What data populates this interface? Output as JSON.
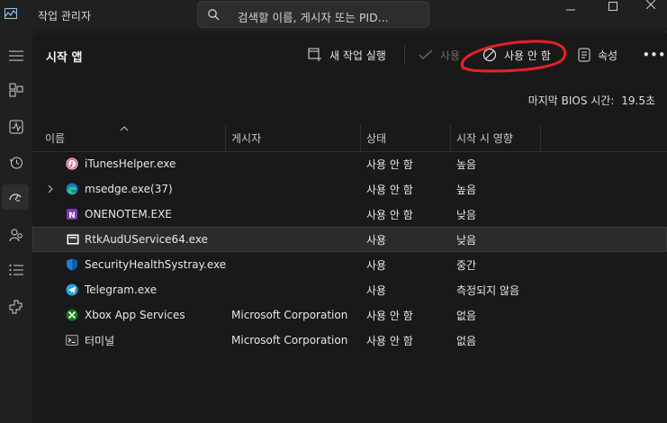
{
  "window": {
    "title": "작업 관리자",
    "search_placeholder": "검색할 이름, 게시자 또는 PID..."
  },
  "sidebar": {
    "items": [
      {
        "icon": "hamburger-menu-icon"
      },
      {
        "icon": "processes-icon"
      },
      {
        "icon": "performance-icon"
      },
      {
        "icon": "app-history-icon"
      },
      {
        "icon": "startup-apps-icon",
        "active": true
      },
      {
        "icon": "users-icon"
      },
      {
        "icon": "details-icon"
      },
      {
        "icon": "services-icon"
      }
    ]
  },
  "page": {
    "title": "시작 앱"
  },
  "toolbar": {
    "new_task": "새 작업 실행",
    "enable": "사용",
    "disable": "사용 안 함",
    "properties": "속성",
    "more": "•••"
  },
  "bios": {
    "label": "마지막 BIOS 시간:",
    "value": "19.5초"
  },
  "table": {
    "columns": [
      "이름",
      "게시자",
      "상태",
      "시작 시 영향"
    ],
    "rows": [
      {
        "name": "iTunesHelper.exe",
        "publisher": "",
        "status": "사용 안 함",
        "impact": "높음",
        "icon": "itunes-icon"
      },
      {
        "name": "msedge.exe(37)",
        "publisher": "",
        "status": "사용 안 함",
        "impact": "높음",
        "icon": "edge-icon",
        "expandable": true
      },
      {
        "name": "ONENOTEM.EXE",
        "publisher": "",
        "status": "사용 안 함",
        "impact": "낮음",
        "icon": "onenote-icon"
      },
      {
        "name": "RtkAudUService64.exe",
        "publisher": "",
        "status": "사용",
        "impact": "낮음",
        "icon": "realtek-icon",
        "selected": true
      },
      {
        "name": "SecurityHealthSystray.exe",
        "publisher": "",
        "status": "사용",
        "impact": "중간",
        "icon": "windows-security-icon"
      },
      {
        "name": "Telegram.exe",
        "publisher": "",
        "status": "사용",
        "impact": "측정되지 않음",
        "icon": "telegram-icon"
      },
      {
        "name": "Xbox App Services",
        "publisher": "Microsoft Corporation",
        "status": "사용 안 함",
        "impact": "없음",
        "icon": "xbox-icon"
      },
      {
        "name": "터미널",
        "publisher": "Microsoft Corporation",
        "status": "사용 안 함",
        "impact": "없음",
        "icon": "terminal-icon"
      }
    ]
  },
  "colors": {
    "background": "#191919",
    "annotation": "#e8202a",
    "accent_edge": "#0f7ccf"
  }
}
